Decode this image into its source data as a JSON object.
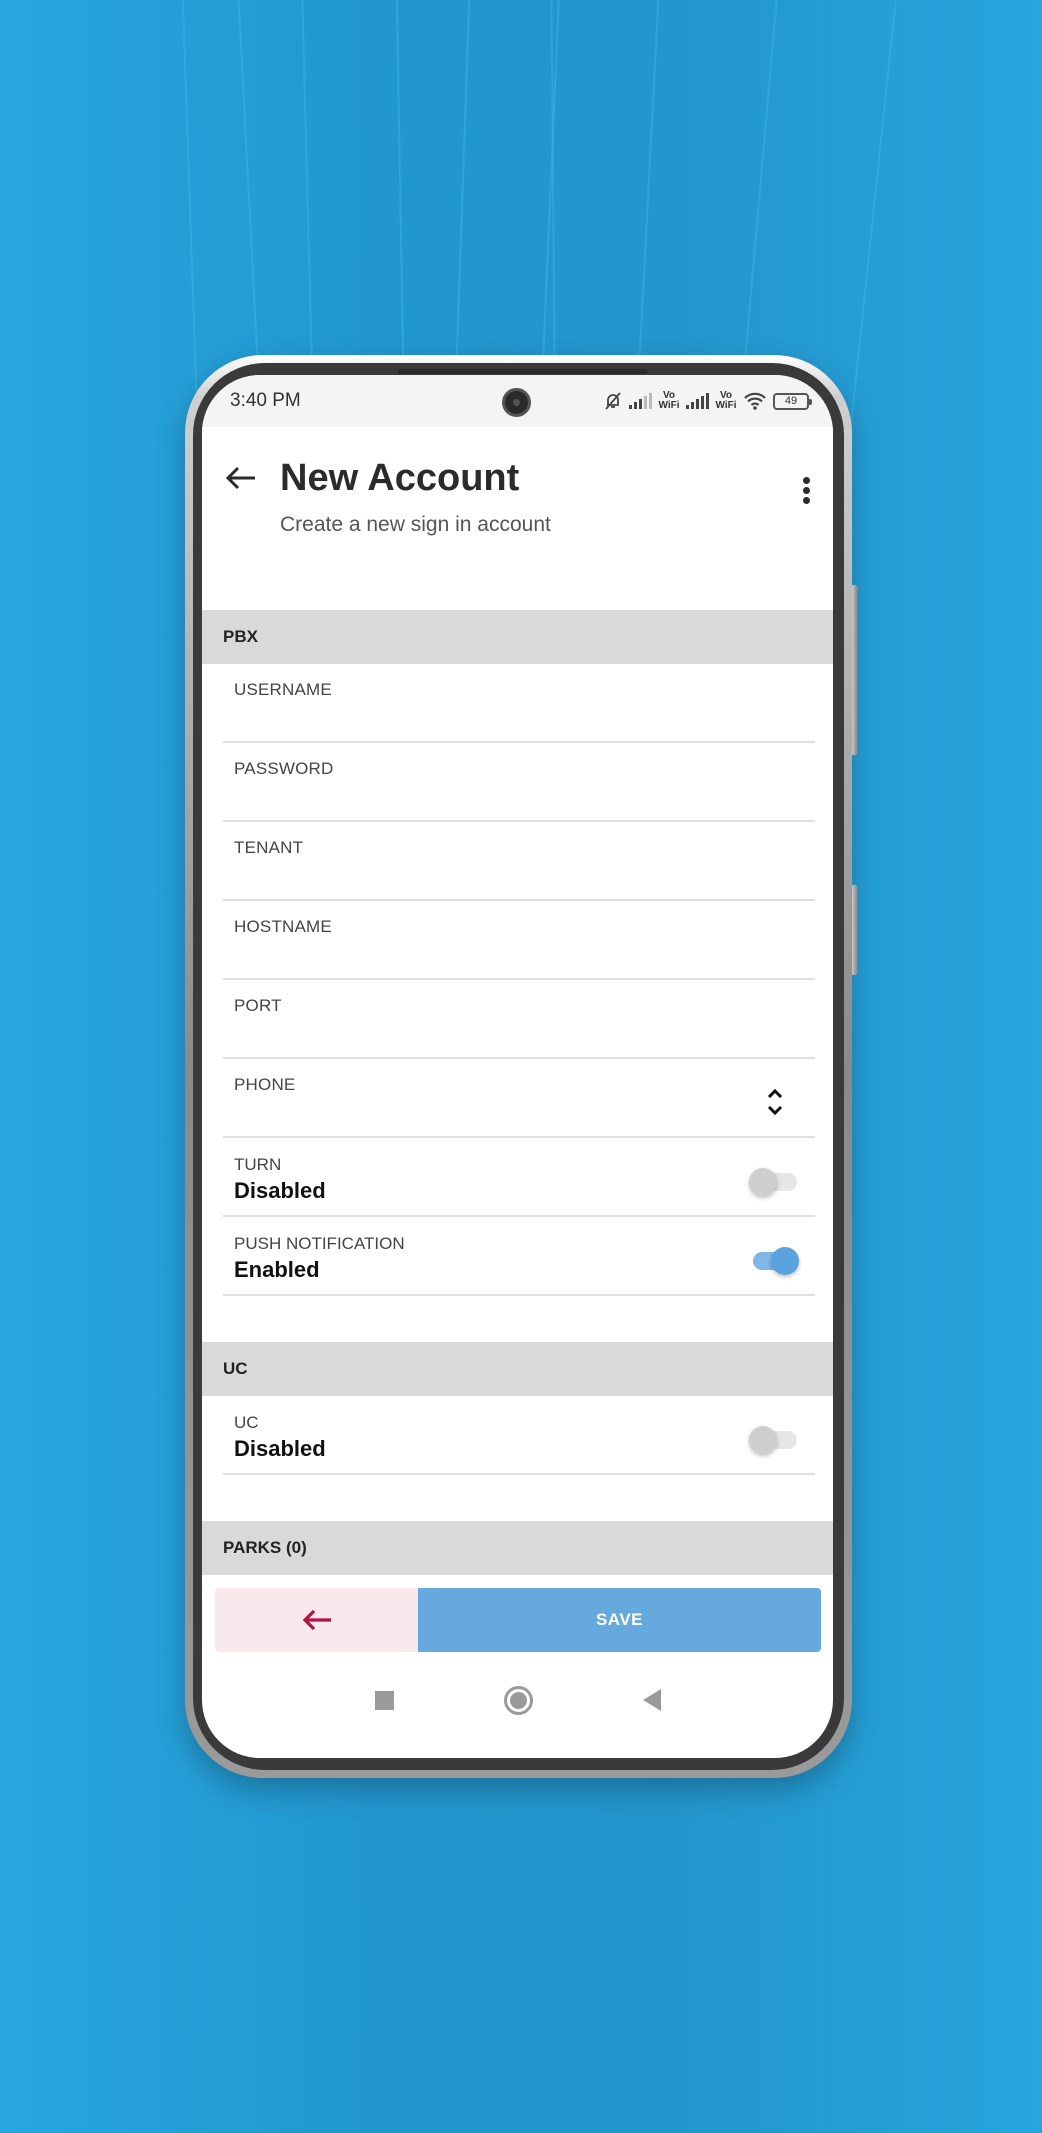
{
  "status_bar": {
    "time": "3:40 PM",
    "vowifi_1": "Vo WiFi",
    "vowifi_2": "Vo WiFi",
    "battery": "49",
    "icons": [
      "mute-bell-icon",
      "signal-icon",
      "vowifi-icon",
      "signal-icon",
      "vowifi-icon",
      "wifi-icon",
      "battery-icon"
    ]
  },
  "header": {
    "title": "New Account",
    "subtitle": "Create a new sign in account",
    "back_icon": "arrow-left-icon",
    "menu_icon": "more-vertical-icon"
  },
  "sections": {
    "pbx": {
      "title": "PBX",
      "fields": {
        "username": {
          "label": "USERNAME",
          "value": ""
        },
        "password": {
          "label": "PASSWORD",
          "value": ""
        },
        "tenant": {
          "label": "TENANT",
          "value": ""
        },
        "hostname": {
          "label": "HOSTNAME",
          "value": ""
        },
        "port": {
          "label": "PORT",
          "value": ""
        },
        "phone": {
          "label": "PHONE",
          "value": ""
        }
      },
      "toggles": {
        "turn": {
          "label": "TURN",
          "value": "Disabled",
          "on": false
        },
        "push": {
          "label": "PUSH NOTIFICATION",
          "value": "Enabled",
          "on": true
        }
      }
    },
    "uc": {
      "title": "UC",
      "toggle": {
        "label": "UC",
        "value": "Disabled",
        "on": false
      }
    },
    "parks": {
      "title": "PARKS (0)"
    }
  },
  "footer": {
    "back_icon": "arrow-left-icon",
    "save_label": "SAVE"
  },
  "colors": {
    "accent": "#66a9dd",
    "back_button_bg": "#f9e9ec",
    "back_arrow": "#b5123f",
    "section_bg": "#d9d9d9",
    "background": "#2298cf"
  }
}
